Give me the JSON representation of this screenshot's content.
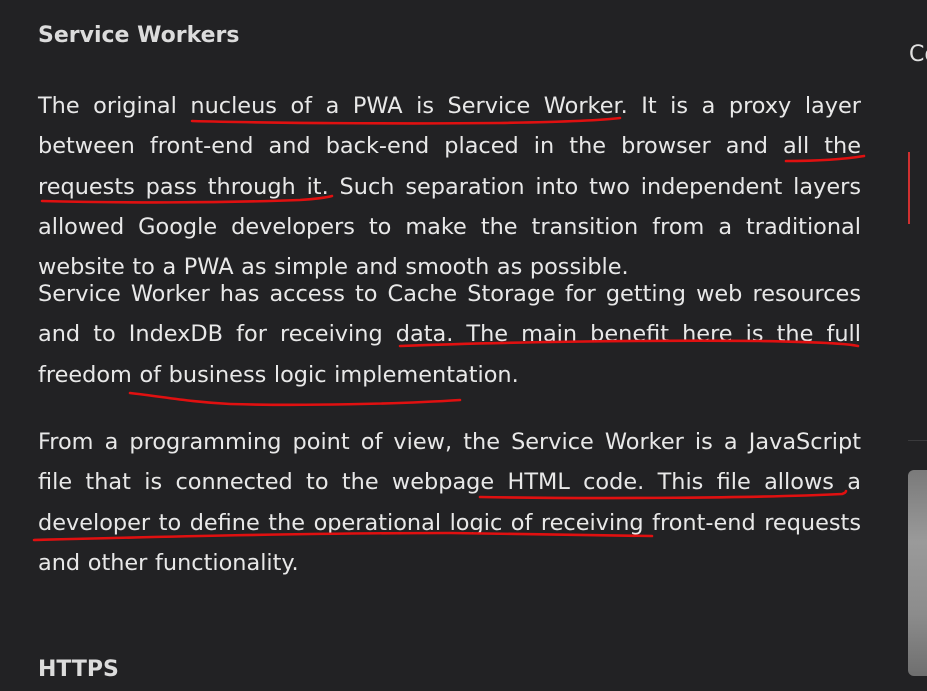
{
  "article": {
    "heading": "Service Workers",
    "paragraphs": [
      "The original nucleus of a PWA is Service Worker. It is a proxy layer between front-end and back-end placed in the browser and all the requests pass through it. Such separation into two independent layers allowed Google developers to make the transition from a traditional website to a PWA as simple and smooth as possible.",
      "Service Worker has access to Cache Storage for getting web resources and to IndexDB for receiving data. The main benefit here is the full freedom of business logic implementation.",
      "From a programming point of view, the Service Worker is a JavaScript file that is connected to the webpage HTML code. This file allows a developer to define the operational logic of receiving front-end requests and other functionality."
    ],
    "next_heading": "HTTPS"
  },
  "sidebar": {
    "label_fragment": "Co"
  },
  "annotations": {
    "color": "#e01010",
    "type": "hand-drawn underline",
    "underlined_phrases": [
      "nucleus of a PWA is Service Worker",
      "all the requests pass through it.",
      "Cache Storage for getting web resources",
      "IndexDB for receiving data",
      "Service Worker is a JavaScript file that is connected to the webpage HTML code."
    ]
  }
}
